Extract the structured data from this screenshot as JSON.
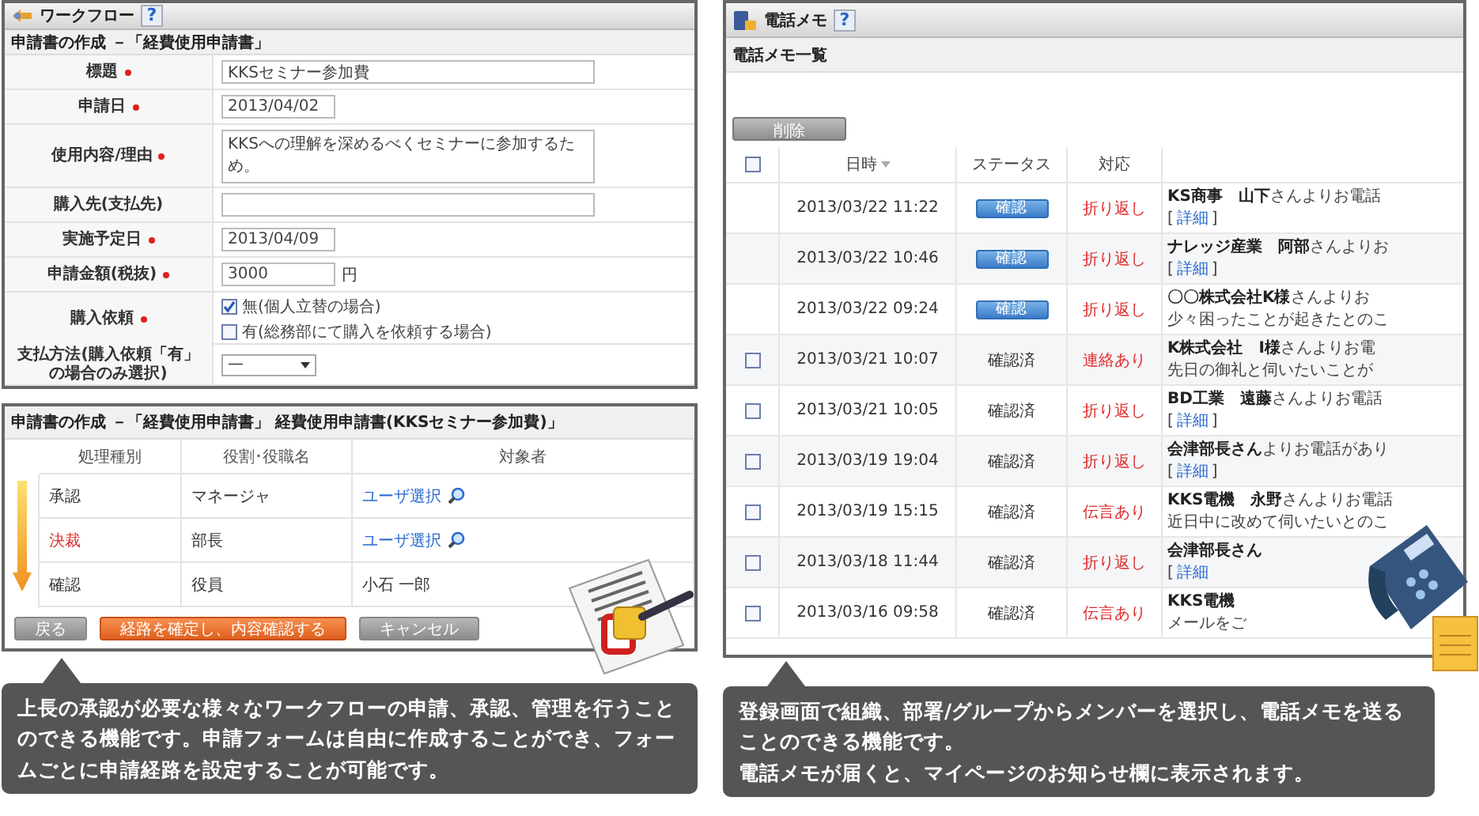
{
  "workflow_form": {
    "title": "ワークフロー",
    "help": "?",
    "subtitle": "申請書の作成 －「経費使用申請書」",
    "fields": [
      {
        "kind": "text",
        "label": "標題",
        "required": true,
        "value": "KKSセミナー参加費"
      },
      {
        "kind": "date",
        "label": "申請日",
        "required": true,
        "value": "2013/04/02"
      },
      {
        "kind": "textarea",
        "label": "使用内容/理由",
        "required": true,
        "value": "KKSへの理解を深めるべくセミナーに参加するため。"
      },
      {
        "kind": "text",
        "label": "購入先(支払先)",
        "required": false
      },
      {
        "kind": "date",
        "label": "実施予定日",
        "required": true,
        "value": "2013/04/09"
      },
      {
        "kind": "amount",
        "label": "申請金額(税抜)",
        "required": true,
        "value": "3000",
        "unit": "円"
      },
      {
        "kind": "checkboxes",
        "label": "購入依頼",
        "required": true,
        "options": [
          {
            "label": "無(個人立替の場合)",
            "checked": true
          },
          {
            "label": "有(総務部にて購入を依頼する場合)",
            "checked": false
          }
        ]
      },
      {
        "kind": "select",
        "label": "支払方法(購入依頼「有」の場合のみ選択)",
        "required": false,
        "value": "—"
      }
    ]
  },
  "route": {
    "title": "申請書の作成 －「経費使用申請書」 経費使用申請書(KKSセミナー参加費)」",
    "columns": [
      "処理種別",
      "役割･役職名",
      "対象者"
    ],
    "rows": [
      {
        "type": "承認",
        "highlight": false,
        "role": "マネージャ",
        "target": {
          "kind": "link",
          "label": "ユーザ選択"
        }
      },
      {
        "type": "決裁",
        "highlight": true,
        "role": "部長",
        "target": {
          "kind": "link",
          "label": "ユーザ選択"
        }
      },
      {
        "type": "確認",
        "highlight": false,
        "role": "役員",
        "target": {
          "kind": "name",
          "label": "小石 一郎"
        }
      }
    ],
    "buttons": [
      {
        "label": "戻る",
        "kind": "gray"
      },
      {
        "label": "経路を確定し、内容確認する",
        "kind": "primary"
      },
      {
        "label": "キャンセル",
        "kind": "gray"
      }
    ]
  },
  "workflow_callout": {
    "paragraphs": [
      "上長の承認が必要な様々なワークフローの申請、承認、管理を行うことのできる機能です。申請フォームは自由に作成することができ、フォームごとに申請経路を設定することが可能です。"
    ]
  },
  "phone_memo": {
    "title": "電話メモ",
    "help": "?",
    "subtitle": "電話メモ一覧",
    "delete_button": "削除",
    "select_all": {
      "checked": false
    },
    "columns": [
      {
        "label": "日時",
        "sorted": true
      },
      {
        "label": "ステータス",
        "sorted": false
      },
      {
        "label": "対応",
        "sorted": false
      }
    ],
    "rows": [
      {
        "datetime": "2013/03/22 11:22",
        "status": {
          "kind": "button",
          "label": "確認"
        },
        "response": "折り返し",
        "message": "**KS商事　山下**さんよりお電話",
        "line2": {
          "kind": "link",
          "open": "[",
          "link": "詳細",
          "close": "]"
        }
      },
      {
        "datetime": "2013/03/22 10:46",
        "status": {
          "kind": "button",
          "label": "確認"
        },
        "response": "折り返し",
        "message": "**ナレッジ産業　阿部**さんよりお",
        "line2": {
          "kind": "link",
          "open": "[",
          "link": "詳細",
          "close": "]"
        }
      },
      {
        "datetime": "2013/03/22 09:24",
        "status": {
          "kind": "button",
          "label": "確認"
        },
        "response": "折り返し",
        "message": "**〇〇株式会社K様**さんよりお",
        "line2": {
          "kind": "note",
          "text": "少々困ったことが起きたとのこ"
        }
      },
      {
        "checked": false,
        "datetime": "2013/03/21 10:07",
        "status": {
          "kind": "text",
          "label": "確認済"
        },
        "response": "連絡あり",
        "message": "**K株式会社　I様**さんよりお電",
        "line2": {
          "kind": "note",
          "text": "先日の御礼と伺いたいことが"
        }
      },
      {
        "checked": false,
        "datetime": "2013/03/21 10:05",
        "status": {
          "kind": "text",
          "label": "確認済"
        },
        "response": "折り返し",
        "message": "**BD工業　遠藤**さんよりお電話",
        "line2": {
          "kind": "link",
          "open": "[",
          "link": "詳細",
          "close": "]"
        }
      },
      {
        "checked": false,
        "datetime": "2013/03/19 19:04",
        "status": {
          "kind": "text",
          "label": "確認済"
        },
        "response": "折り返し",
        "message": "**会津部長さん**よりお電話があり",
        "line2": {
          "kind": "link",
          "open": "[",
          "link": "詳細",
          "close": "]"
        }
      },
      {
        "checked": false,
        "datetime": "2013/03/19 15:15",
        "status": {
          "kind": "text",
          "label": "確認済"
        },
        "response": "伝言あり",
        "message": "**KKS電機　永野**さんよりお電話",
        "line2": {
          "kind": "note",
          "text": "近日中に改めて伺いたいとのこ"
        }
      },
      {
        "checked": false,
        "datetime": "2013/03/18 11:44",
        "status": {
          "kind": "text",
          "label": "確認済"
        },
        "response": "折り返し",
        "message": "**会津部長さん**",
        "line2": {
          "kind": "link",
          "open": "[",
          "link": "詳細"
        }
      },
      {
        "checked": false,
        "datetime": "2013/03/16 09:58",
        "status": {
          "kind": "text",
          "label": "確認済"
        },
        "response": "伝言あり",
        "message": "**KKS電機**",
        "line2": {
          "kind": "note",
          "text": "メールをご"
        }
      }
    ]
  },
  "phone_callout": {
    "paragraphs": [
      "登録画面で組織、部署/グループからメンバーを選択し、電話メモを送ることのできる機能です。",
      "電話メモが届くと、マイページのお知らせ欄に表示されます。"
    ]
  }
}
